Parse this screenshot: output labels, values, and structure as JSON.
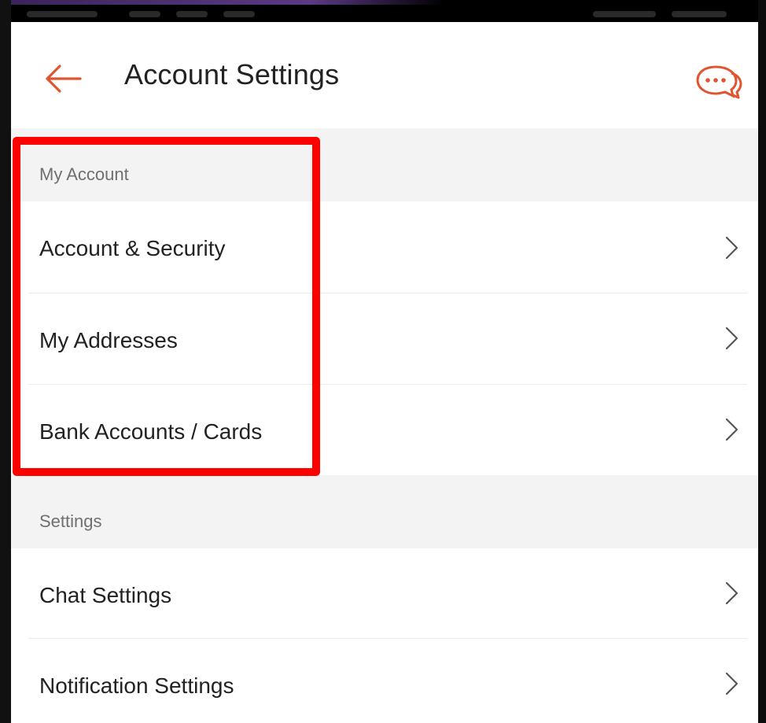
{
  "header": {
    "title": "Account Settings",
    "back_icon": "arrow-left-icon",
    "chat_icon": "chat-bubbles-icon"
  },
  "sections": [
    {
      "label": "My Account",
      "items": [
        {
          "label": "Account & Security",
          "icon": "chevron-right-icon"
        },
        {
          "label": "My Addresses",
          "icon": "chevron-right-icon"
        },
        {
          "label": "Bank Accounts / Cards",
          "icon": "chevron-right-icon"
        }
      ]
    },
    {
      "label": "Settings",
      "items": [
        {
          "label": "Chat Settings",
          "icon": "chevron-right-icon"
        },
        {
          "label": "Notification Settings",
          "icon": "chevron-right-icon"
        }
      ]
    }
  ],
  "colors": {
    "accent": "#e0552f",
    "highlight": "#ff0000",
    "section_bg": "#f3f3f3",
    "text": "#222222",
    "muted_text": "#6f6f6f"
  }
}
